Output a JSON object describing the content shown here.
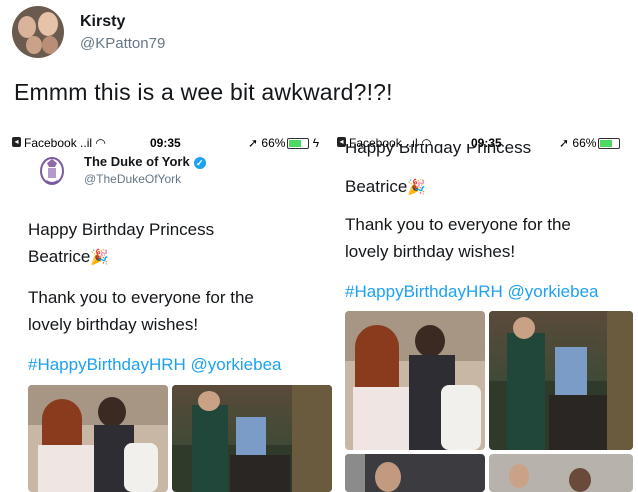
{
  "author": {
    "name": "Kirsty",
    "handle": "@KPatton79"
  },
  "tweet": {
    "text": "Emmm this is a wee bit awkward?!?!"
  },
  "left": {
    "status": {
      "carrier": "Facebook",
      "signal": "..il",
      "time": "09:35",
      "battery": "66%"
    },
    "account": {
      "name": "The Duke of York",
      "handle": "@TheDukeOfYork"
    },
    "line1": "Happy Birthday Princess",
    "line2": "Beatrice",
    "line3": "Thank you to everyone for the",
    "line4": "lovely birthday wishes!",
    "hashtags": "#HappyBirthdayHRH @yorkiebea"
  },
  "right": {
    "status": {
      "carrier": "Facebook",
      "signal": "..ıl",
      "time": "09:35",
      "battery": "66%"
    },
    "cut_line": "Happy Birthday Princess",
    "line2": "Beatrice",
    "line3": "Thank you to everyone for the",
    "line4": "lovely birthday wishes!",
    "hashtags": "#HappyBirthdayHRH @yorkiebea"
  },
  "icons": {
    "verified": "verified-badge-icon",
    "confetti": "party-popper-icon",
    "wifi": "wifi-icon",
    "location": "location-arrow-icon"
  }
}
